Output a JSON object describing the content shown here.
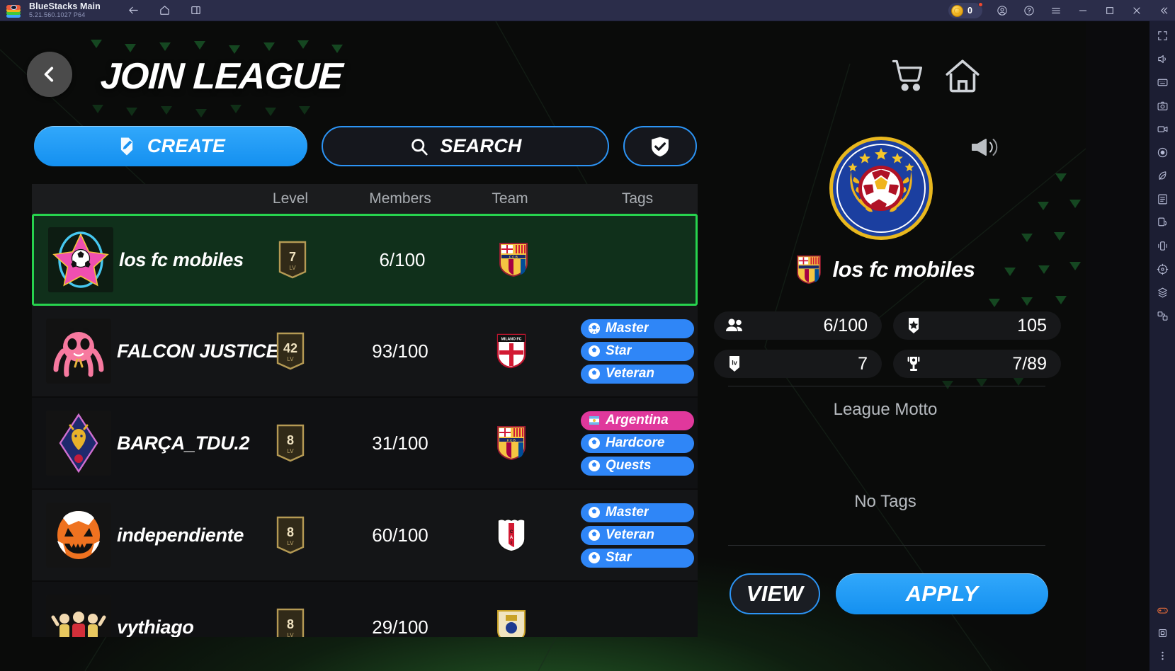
{
  "titlebar": {
    "app_name": "BlueStacks Main",
    "version": "5.21.560.1027  P64",
    "nav": [
      {
        "name": "back-icon",
        "label": "Back"
      },
      {
        "name": "home-icon",
        "label": "Home"
      },
      {
        "name": "multi-instance-icon",
        "label": "Instances"
      }
    ],
    "coin_count": "0",
    "window_controls": [
      {
        "name": "account-icon",
        "label": "Account"
      },
      {
        "name": "help-icon",
        "label": "Help"
      },
      {
        "name": "menu-icon",
        "label": "Menu"
      },
      {
        "name": "minimize-icon",
        "label": "Minimize"
      },
      {
        "name": "maximize-icon",
        "label": "Maximize"
      },
      {
        "name": "close-icon",
        "label": "Close"
      },
      {
        "name": "collapse-sidebar-icon",
        "label": "Collapse"
      }
    ]
  },
  "sidebar": {
    "top_items": [
      {
        "name": "fullscreen-icon"
      },
      {
        "name": "volume-icon"
      },
      {
        "name": "keyboard-controls-icon"
      },
      {
        "name": "screenshot-icon"
      },
      {
        "name": "video-record-icon"
      },
      {
        "name": "macro-record-icon"
      },
      {
        "name": "eco-mode-icon"
      },
      {
        "name": "script-icon"
      },
      {
        "name": "rotate-icon"
      },
      {
        "name": "shake-icon"
      },
      {
        "name": "location-icon"
      },
      {
        "name": "multi-instance-manager-icon"
      },
      {
        "name": "sync-operations-icon"
      }
    ],
    "bottom_items": [
      {
        "name": "gamepad-icon"
      },
      {
        "name": "trim-memory-icon"
      },
      {
        "name": "more-icon"
      }
    ]
  },
  "header": {
    "title": "JOIN LEAGUE",
    "back_button": "back-chevron-icon",
    "cart_icon": "shopping-cart-icon",
    "home_icon": "home-icon"
  },
  "toolbar": {
    "create_label": "CREATE",
    "search_label": "SEARCH",
    "check_label": "",
    "megaphone_icon": "megaphone-icon"
  },
  "table": {
    "columns": [
      "Level",
      "Members",
      "Team",
      "Tags"
    ],
    "rows": [
      {
        "name": "los fc mobiles",
        "level": "7",
        "level_suffix": "LV",
        "members": "6/100",
        "team": "fcb-crest",
        "tags": [],
        "selected": true,
        "avatar": "pink-star-ball-avatar"
      },
      {
        "name": "FALCON JUSTICE",
        "level": "42",
        "level_suffix": "LV",
        "members": "93/100",
        "team": "milano-fc-crest",
        "tags": [
          {
            "label": "Master",
            "color": "#2f86f7"
          },
          {
            "label": "Star",
            "color": "#2f86f7"
          },
          {
            "label": "Veteran",
            "color": "#2f86f7"
          }
        ],
        "selected": false,
        "avatar": "pink-octopus-avatar"
      },
      {
        "name": "BARÇA_TDU.2",
        "level": "8",
        "level_suffix": "LV",
        "members": "31/100",
        "team": "fcb-crest",
        "tags": [
          {
            "label": "Argentina",
            "color": "#e0389c"
          },
          {
            "label": "Hardcore",
            "color": "#2f86f7"
          },
          {
            "label": "Quests",
            "color": "#2f86f7"
          }
        ],
        "selected": false,
        "avatar": "blue-diamond-lion-avatar"
      },
      {
        "name": "independiente",
        "level": "8",
        "level_suffix": "LV",
        "members": "60/100",
        "team": "cai-crest",
        "tags": [
          {
            "label": "Master",
            "color": "#2f86f7"
          },
          {
            "label": "Veteran",
            "color": "#2f86f7"
          },
          {
            "label": "Star",
            "color": "#2f86f7"
          }
        ],
        "selected": false,
        "avatar": "orange-pumpkin-ball-avatar"
      },
      {
        "name": "vythiago",
        "level": "8",
        "level_suffix": "LV",
        "members": "29/100",
        "team": "rm-crest",
        "tags": [],
        "selected": false,
        "avatar": "celebration-avatar"
      }
    ]
  },
  "detail": {
    "emblem": "league-emblem-blue-laurel",
    "crest": "fcb-crest",
    "name": "los fc mobiles",
    "stats": [
      {
        "icon": "members-icon",
        "value": "6/100"
      },
      {
        "icon": "star-shield-icon",
        "value": "105"
      },
      {
        "icon": "level-icon",
        "value": "7"
      },
      {
        "icon": "trophy-icon",
        "value": "7/89"
      }
    ],
    "motto_label": "League Motto",
    "tags_label": "No Tags",
    "view_label": "VIEW",
    "apply_label": "APPLY"
  },
  "colors": {
    "accent_blue": "#2f86f7",
    "selected_green": "#27d34e",
    "tag_pink": "#e0389c",
    "panel_dark": "#141517"
  }
}
